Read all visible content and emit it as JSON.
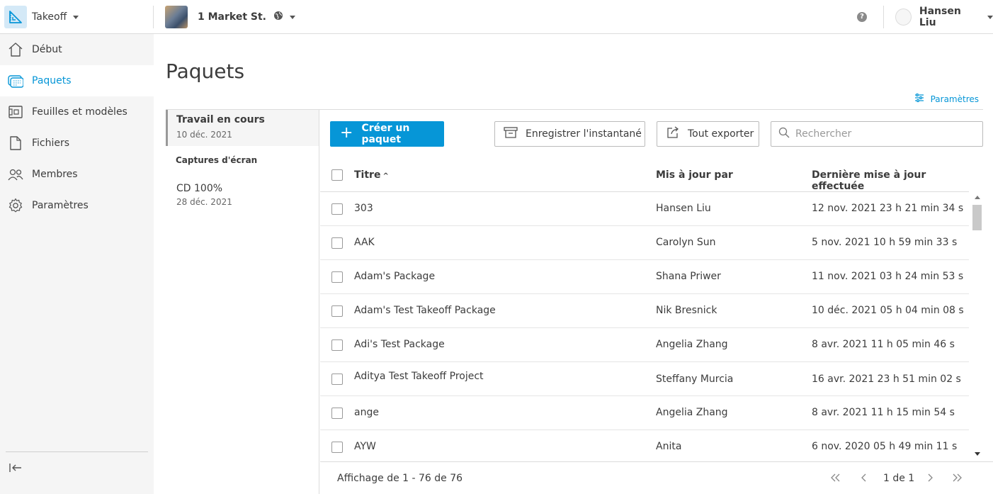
{
  "topbar": {
    "app_name": "Takeoff",
    "project_name": "1 Market St.",
    "user_name": "Hansen Liu",
    "help_glyph": "?"
  },
  "sidebar": {
    "items": [
      {
        "label": "Début",
        "icon": "home-icon"
      },
      {
        "label": "Paquets",
        "icon": "packages-icon",
        "active": true
      },
      {
        "label": "Feuilles et modèles",
        "icon": "sheets-icon"
      },
      {
        "label": "Fichiers",
        "icon": "file-icon"
      },
      {
        "label": "Membres",
        "icon": "members-icon"
      },
      {
        "label": "Paramètres",
        "icon": "gear-icon"
      }
    ]
  },
  "page": {
    "title": "Paquets",
    "settings_label": "Paramètres"
  },
  "versions": {
    "current": {
      "title": "Travail en cours",
      "date": "10 déc. 2021"
    },
    "section_label": "Captures d'écran",
    "snapshots": [
      {
        "title": "CD 100%",
        "date": "28 déc. 2021"
      }
    ]
  },
  "toolbar": {
    "create_label": "Créer un paquet",
    "snapshot_label": "Enregistrer l'instantané",
    "export_label": "Tout exporter",
    "search_placeholder": "Rechercher"
  },
  "table": {
    "columns": {
      "title": "Titre",
      "updated_by": "Mis à jour par",
      "updated_at": "Dernière mise à jour effectuée"
    },
    "sort_indicator": "^",
    "rows": [
      {
        "title": "303",
        "by": "Hansen Liu",
        "date": "12 nov. 2021 23 h 21 min 34 s"
      },
      {
        "title": "AAK",
        "by": "Carolyn Sun",
        "date": "5 nov. 2021 10 h 59 min 33 s"
      },
      {
        "title": "Adam's Package",
        "by": "Shana Priwer",
        "date": "11 nov. 2021 03 h 24 min 53 s"
      },
      {
        "title": "Adam's Test Takeoff Package",
        "by": "Nik Bresnick",
        "date": "10 déc. 2021 05 h 04 min 08 s"
      },
      {
        "title": "Adi's Test Package",
        "by": "Angelia Zhang",
        "date": "8 avr. 2021 11 h 05 min 46 s"
      },
      {
        "title": "Aditya Test Takeoff Project",
        "by": "Steffany Murcia",
        "date": "16 avr. 2021 23 h 51 min 02 s"
      },
      {
        "title": "ange",
        "by": "Angelia Zhang",
        "date": "8 avr. 2021 11 h 15 min 54 s"
      },
      {
        "title": "AYW",
        "by": "Anita",
        "date": "6 nov. 2020 05 h 49 min 11 s"
      }
    ]
  },
  "footer": {
    "count_text": "Affichage de 1 - 76 de 76",
    "page_text": "1 de 1"
  },
  "colors": {
    "accent": "#0696d7",
    "sidebar_bg": "#f5f5f5",
    "border": "#dcdcdc"
  }
}
